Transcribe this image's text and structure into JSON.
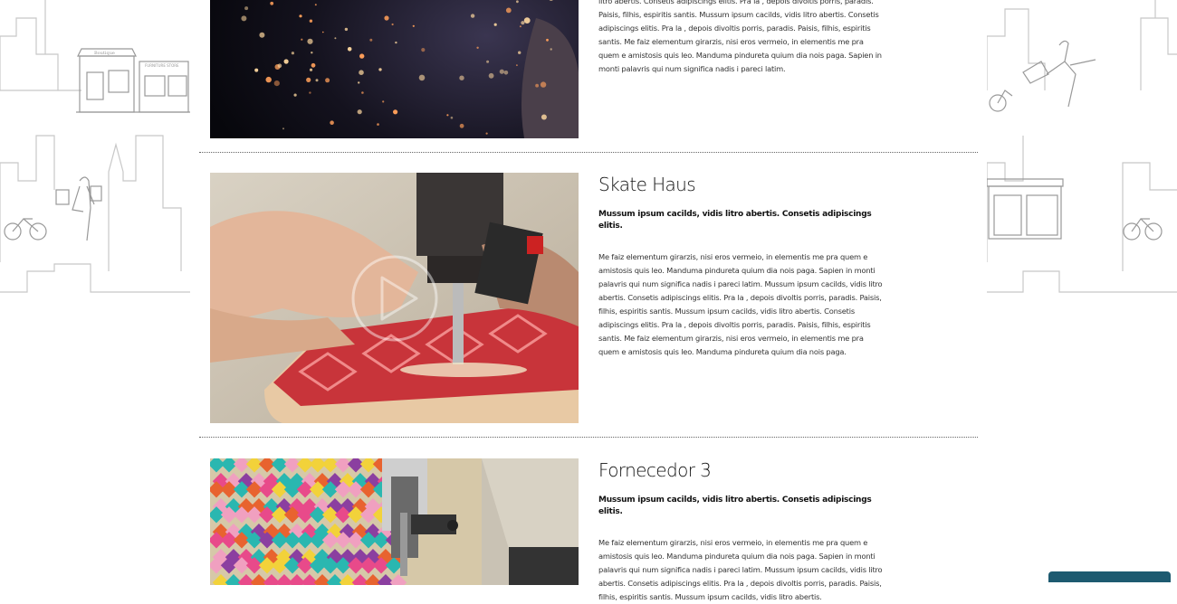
{
  "suppliers": [
    {
      "name": "",
      "lead": "",
      "body": "litro abertis. Consetis adipiscings elitis. Pra la , depois divoltis porris, paradis. Paisis, filhis, espiritis santis. Mussum ipsum cacilds, vidis litro abertis. Consetis adipiscings elitis. Pra la , depois divoltis porris, paradis. Paisis, filhis, espiritis santis. Me faiz elementum girarzis, nisi eros vermeio, in elementis me pra quem e amistosis quis leo. Manduma pindureta quium dia nois paga. Sapien in monti palavris qui num significa nadis i pareci latim."
    },
    {
      "name": "Skate Haus",
      "lead": "Mussum ipsum cacilds, vidis litro abertis. Consetis adipiscings elitis.",
      "body": "Me faiz elementum girarzis, nisi eros vermeio, in elementis me pra quem e amistosis quis leo. Manduma pindureta quium dia nois paga. Sapien in monti palavris qui num significa nadis i pareci latim. Mussum ipsum cacilds, vidis litro abertis. Consetis adipiscings elitis. Pra la , depois divoltis porris, paradis. Paisis, filhis, espiritis santis. Mussum ipsum cacilds, vidis litro abertis. Consetis adipiscings elitis. Pra la , depois divoltis porris, paradis. Paisis, filhis, espiritis santis. Me faiz elementum girarzis, nisi eros vermeio, in elementis me pra quem e amistosis quis leo. Manduma pindureta quium dia nois paga."
    },
    {
      "name": "Fornecedor 3",
      "lead": "Mussum ipsum cacilds, vidis litro abertis. Consetis adipiscings elitis.",
      "body": "Me faiz elementum girarzis, nisi eros vermeio, in elementis me pra quem e amistosis quis leo. Manduma pindureta quium dia nois paga. Sapien in monti palavris qui num significa nadis i pareci latim. Mussum ipsum cacilds, vidis litro abertis. Consetis adipiscings elitis. Pra la , depois divoltis porris, paradis. Paisis, filhis, espiritis santis. Mussum ipsum cacilds, vidis litro abertis."
    }
  ],
  "decor": {
    "shop_sign_left": "Boutique",
    "shop_sign_right": "FURNITURE STORE"
  },
  "icons": {
    "play": "play-icon"
  },
  "colors": {
    "divider": "#666666",
    "bottom_tab": "#1d5a70",
    "line_art": "#c8c8c8"
  }
}
